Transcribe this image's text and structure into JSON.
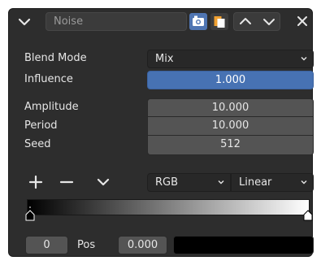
{
  "header": {
    "name_value": "Noise",
    "icons": [
      "chevron-down-icon",
      "camera-icon",
      "copy-icon",
      "move-up-icon",
      "move-down-icon",
      "close-icon"
    ]
  },
  "rows": {
    "blend_mode": {
      "label": "Blend Mode",
      "value": "Mix"
    },
    "influence": {
      "label": "Influence",
      "value": "1.000",
      "fraction": 1.0
    },
    "amplitude": {
      "label": "Amplitude",
      "value": "10.000"
    },
    "period": {
      "label": "Period",
      "value": "10.000"
    },
    "seed": {
      "label": "Seed",
      "value": "512"
    }
  },
  "ramp": {
    "color_mode": "RGB",
    "interpolation": "Linear",
    "stops": [
      {
        "position": 0.0,
        "color": "#000000",
        "active": true
      },
      {
        "position": 1.0,
        "color": "#ffffff",
        "active": false
      }
    ]
  },
  "footer": {
    "index_value": "0",
    "pos_label": "Pos",
    "pos_value": "0.000",
    "swatch_color": "#000000"
  },
  "colors": {
    "panel_bg": "#2d2d2d",
    "accent_blue": "#4772b3",
    "field_bg": "#545454"
  }
}
